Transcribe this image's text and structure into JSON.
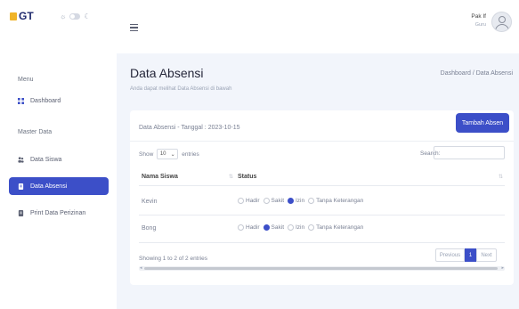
{
  "logo": {
    "text": "GT"
  },
  "sidebar": {
    "menu_heading": "Menu",
    "dashboard_label": "Dashboard",
    "master_heading": "Master Data",
    "items": [
      {
        "label": "Data Siswa"
      },
      {
        "label": "Data Absensi"
      },
      {
        "label": "Print Data Perizinan"
      }
    ]
  },
  "user": {
    "name": "Pak If",
    "role": "Guru"
  },
  "page": {
    "title": "Data Absensi",
    "subtitle": "Anda dapat melihat Data Absensi di bawah",
    "breadcrumb": "Dashboard / Data Absensi"
  },
  "card": {
    "title": "Data Absensi - Tanggal : 2023-10-15",
    "add_button": "Tambah Absen",
    "show_label": "Show",
    "entries_value": "10",
    "entries_label": "entries",
    "search_label": "Search:",
    "columns": [
      "Nama Siswa",
      "Status"
    ],
    "status_options": [
      "Hadir",
      "Sakit",
      "Izin",
      "Tanpa Keterangan"
    ],
    "rows": [
      {
        "name": "Kevin",
        "selected": "Izin"
      },
      {
        "name": "Bong",
        "selected": "Sakit"
      }
    ],
    "showing": "Showing 1 to 2 of 2 entries",
    "pagination": {
      "previous": "Previous",
      "page": "1",
      "next": "Next"
    }
  },
  "colors": {
    "primary": "#3c4fc8",
    "background": "#f2f5fb",
    "logo_accent": "#f0b429"
  }
}
